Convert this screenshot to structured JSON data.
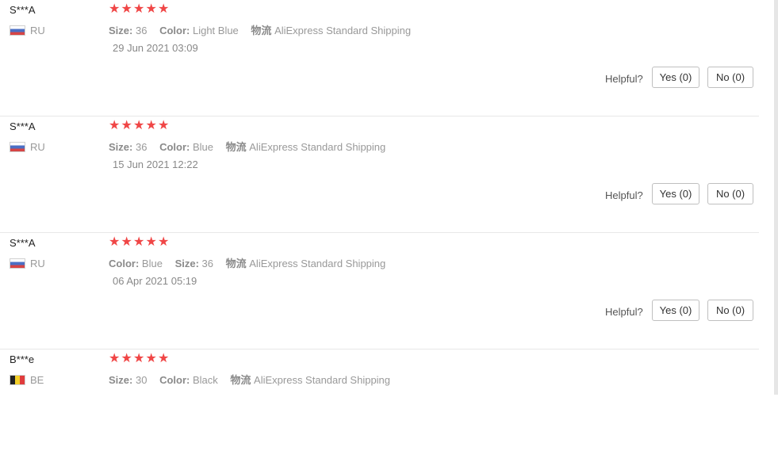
{
  "helpful_label": "Helpful?",
  "rating_star_glyph": "★",
  "star_color": "#f04646",
  "reviews": [
    {
      "user": "S***A",
      "country": "RU",
      "flag": "russia-flag",
      "stars": 5,
      "attrs": [
        {
          "key": "Size:",
          "value": "36"
        },
        {
          "key": "Color:",
          "value": "Light Blue"
        },
        {
          "key": "物流",
          "value": "AliExpress Standard Shipping"
        }
      ],
      "date": "29 Jun 2021 03:09",
      "yes": "Yes (0)",
      "no": "No (0)"
    },
    {
      "user": "S***A",
      "country": "RU",
      "flag": "russia-flag",
      "stars": 5,
      "attrs": [
        {
          "key": "Size:",
          "value": "36"
        },
        {
          "key": "Color:",
          "value": "Blue"
        },
        {
          "key": "物流",
          "value": "AliExpress Standard Shipping"
        }
      ],
      "date": "15 Jun 2021 12:22",
      "yes": "Yes (0)",
      "no": "No (0)"
    },
    {
      "user": "S***A",
      "country": "RU",
      "flag": "russia-flag",
      "stars": 5,
      "attrs": [
        {
          "key": "Color:",
          "value": "Blue"
        },
        {
          "key": "Size:",
          "value": "36"
        },
        {
          "key": "物流",
          "value": "AliExpress Standard Shipping"
        }
      ],
      "date": "06 Apr 2021 05:19",
      "yes": "Yes (0)",
      "no": "No (0)"
    },
    {
      "user": "B***e",
      "country": "BE",
      "flag": "belgium-flag",
      "stars": 5,
      "attrs": [
        {
          "key": "Size:",
          "value": "30"
        },
        {
          "key": "Color:",
          "value": "Black"
        },
        {
          "key": "物流",
          "value": "AliExpress Standard Shipping"
        }
      ],
      "date": "",
      "yes": "",
      "no": ""
    }
  ]
}
